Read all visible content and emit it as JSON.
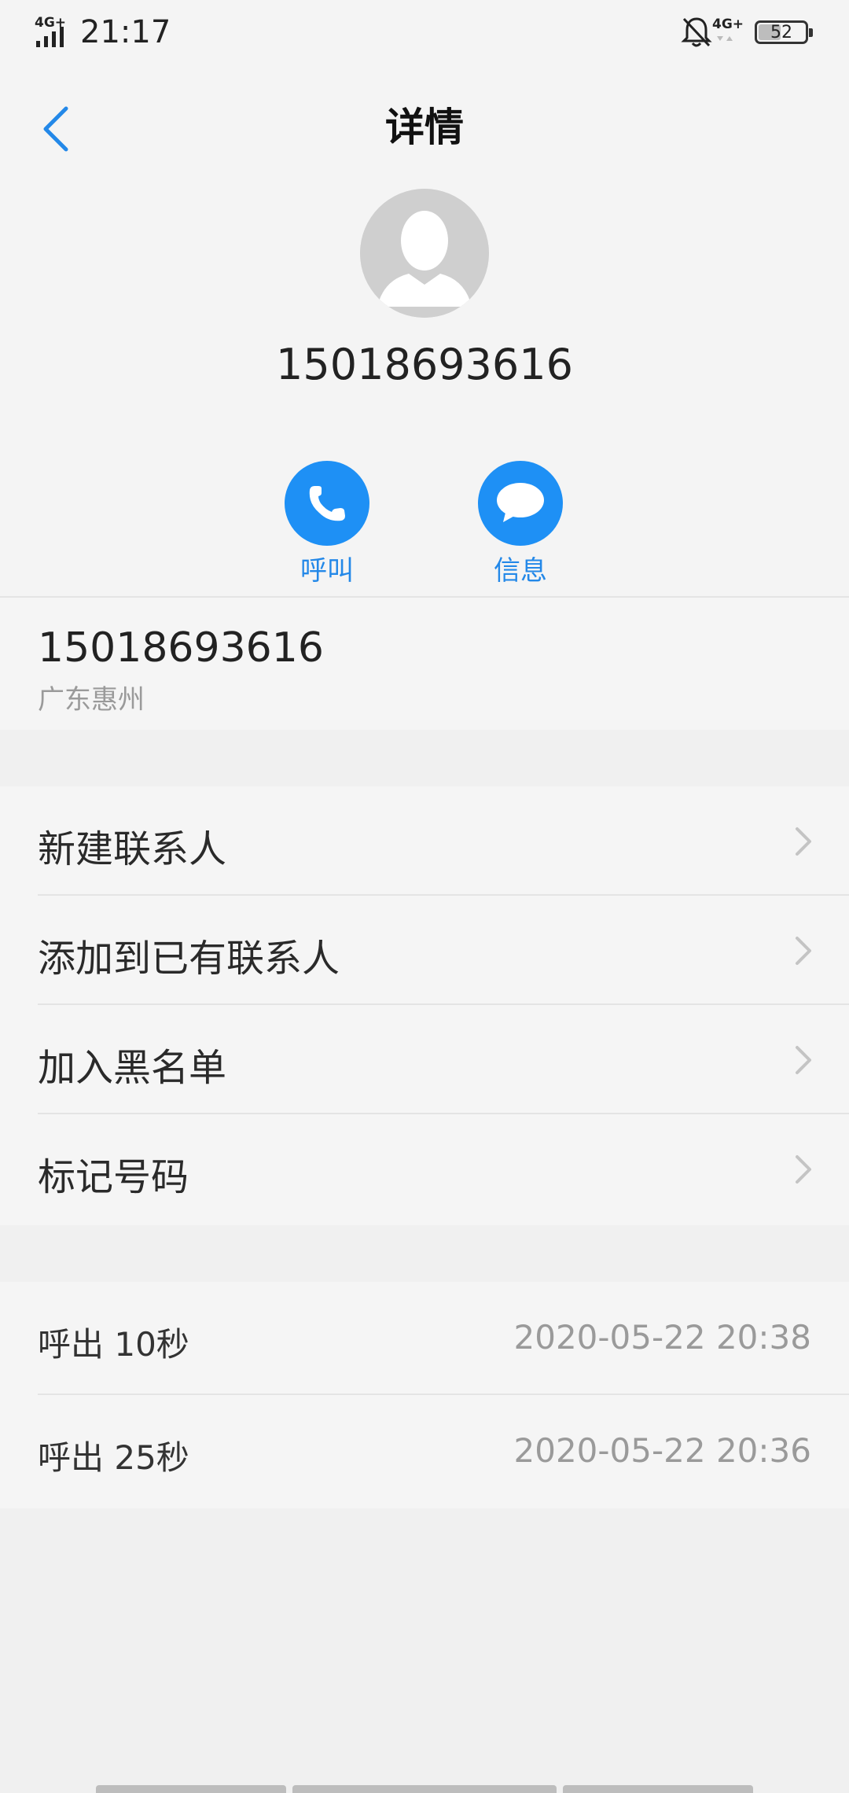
{
  "status_bar": {
    "network_left": "4G+",
    "time": "21:17",
    "network_right": "4G+",
    "battery_level": "52",
    "battery_fraction": 0.52,
    "icons": [
      "signal-icon",
      "bell-off-icon",
      "battery-icon"
    ]
  },
  "header": {
    "title": "详情",
    "back_icon": "chevron-left-icon"
  },
  "contact": {
    "avatar_icon": "person-silhouette-icon",
    "number": "15018693616"
  },
  "actions": {
    "call_label": "呼叫",
    "call_icon": "phone-icon",
    "message_label": "信息",
    "message_icon": "chat-bubble-icon"
  },
  "number_detail": {
    "number": "15018693616",
    "location": "广东惠州"
  },
  "menu": {
    "items": [
      {
        "label": "新建联系人"
      },
      {
        "label": "添加到已有联系人"
      },
      {
        "label": "加入黑名单"
      },
      {
        "label": "标记号码"
      }
    ]
  },
  "history": {
    "rows": [
      {
        "type": "呼出 10秒",
        "when": "2020-05-22 20:38"
      },
      {
        "type": "呼出 25秒",
        "when": "2020-05-22 20:36"
      }
    ]
  },
  "colors": {
    "accent": "#1e90f5",
    "accent_text": "#2388e8",
    "background": "#f0f0f0",
    "section": "#f5f5f5",
    "secondary_text": "#9a9a9a"
  }
}
